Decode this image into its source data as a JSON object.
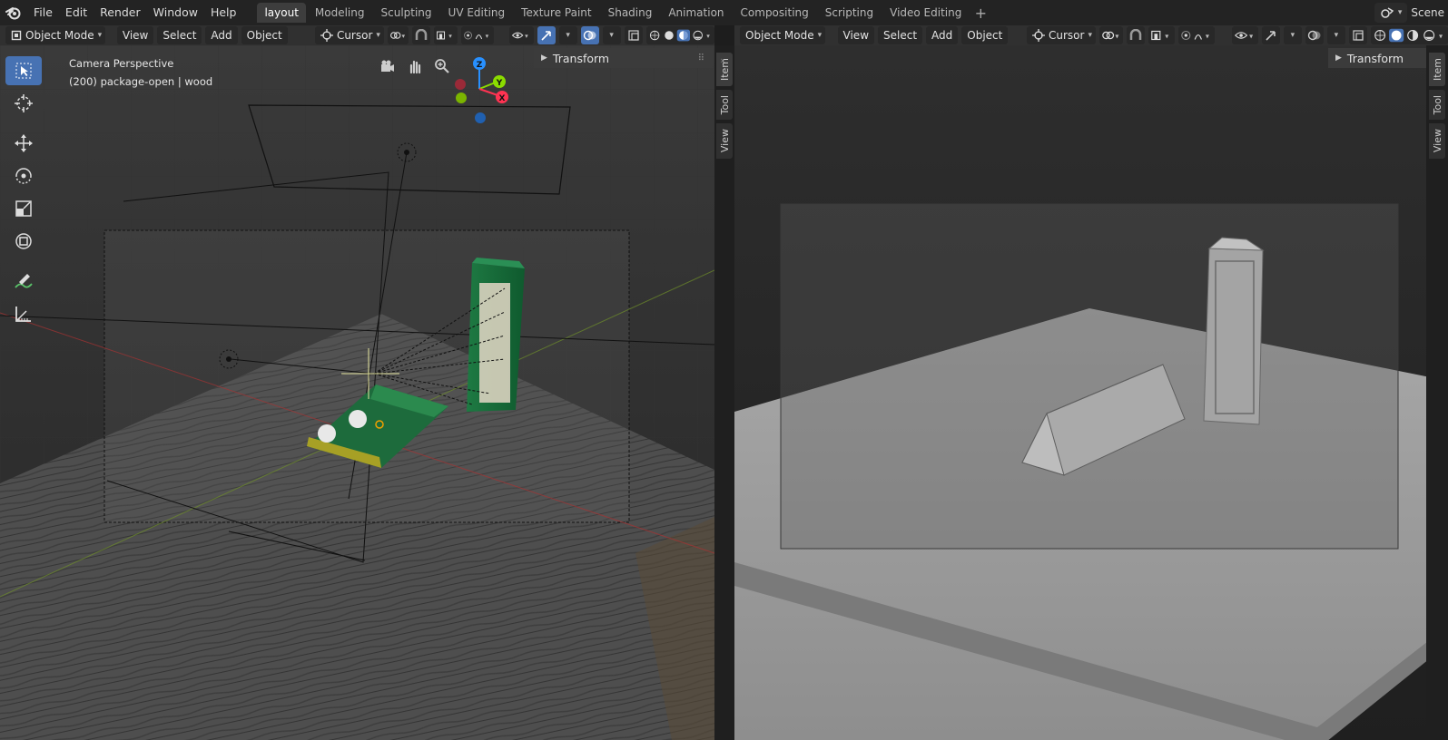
{
  "topbar": {
    "menus": [
      "File",
      "Edit",
      "Render",
      "Window",
      "Help"
    ],
    "workspaces": [
      {
        "label": "layout",
        "active": true
      },
      {
        "label": "Modeling",
        "active": false
      },
      {
        "label": "Sculpting",
        "active": false
      },
      {
        "label": "UV Editing",
        "active": false
      },
      {
        "label": "Texture Paint",
        "active": false
      },
      {
        "label": "Shading",
        "active": false
      },
      {
        "label": "Animation",
        "active": false
      },
      {
        "label": "Compositing",
        "active": false
      },
      {
        "label": "Scripting",
        "active": false
      },
      {
        "label": "Video Editing",
        "active": false
      }
    ],
    "add_tab": "+",
    "scene_label": "Scene"
  },
  "header_left": {
    "mode": "Object Mode",
    "view": "View",
    "select": "Select",
    "add": "Add",
    "object": "Object",
    "pivot": "Cursor"
  },
  "header_right": {
    "mode": "Object Mode",
    "view": "View",
    "select": "Select",
    "add": "Add",
    "object": "Object",
    "pivot": "Cursor"
  },
  "viewport_left": {
    "view_name": "Camera Perspective",
    "object_info": "(200) package-open | wood",
    "gizmo": {
      "z": "Z",
      "y": "Y",
      "x": "X"
    },
    "transform_panel": "Transform"
  },
  "viewport_right": {
    "transform_panel": "Transform"
  },
  "side_tabs": {
    "item": "Item",
    "tool": "Tool",
    "view": "View"
  },
  "colors": {
    "accent": "#4772b3",
    "axis_x": "#ff3352",
    "axis_y": "#8bdc00",
    "axis_z": "#2890ff"
  }
}
